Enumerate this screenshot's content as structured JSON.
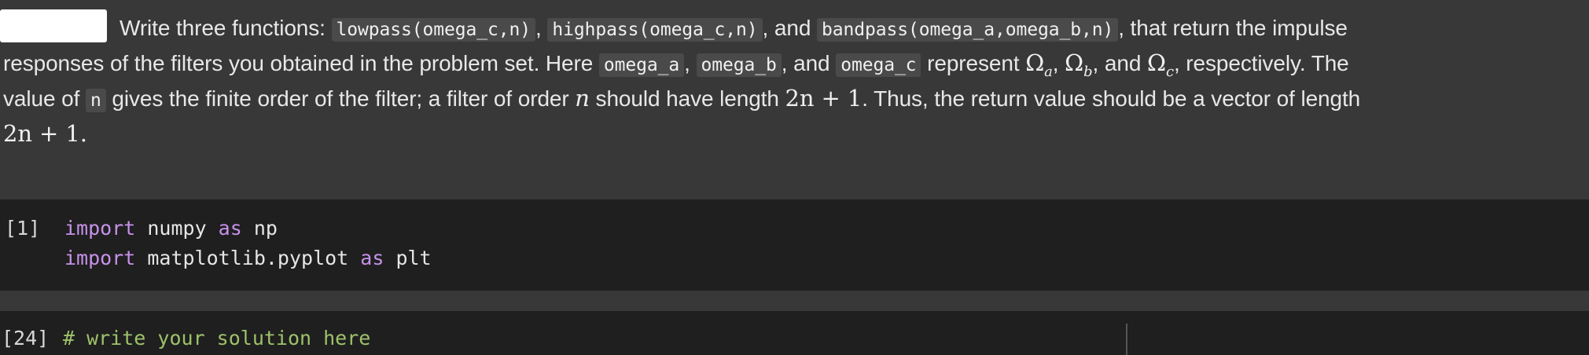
{
  "markdown_cell": {
    "line1": {
      "intro": "Write three functions: ",
      "code1": "lowpass(omega_c,n)",
      "sep1": ", ",
      "code2": "highpass(omega_c,n)",
      "sep2": ", and ",
      "code3": "bandpass(omega_a,omega_b,n)",
      "tail": ", that return the impulse"
    },
    "line2": {
      "text1": "responses of the filters you obtained in the problem set. Here ",
      "code_a": "omega_a",
      "sep1": ", ",
      "code_b": "omega_b",
      "sep2": ", and ",
      "code_c": "omega_c",
      "text2": " represent ",
      "omega": "Ω",
      "sub_a": "a",
      "sub_b": "b",
      "sub_c": "c",
      "comma": ", ",
      "and": ", and ",
      "tail": ", respectively. The"
    },
    "line3": {
      "text1": "value of ",
      "code_n": "n",
      "text2": " gives the finite order of the filter; a filter of order ",
      "var_n": "n",
      "text3": " should have length ",
      "math_len": "2n + 1",
      "text4": ". Thus, the return value should be a vector of length"
    },
    "line4": {
      "math_len": "2n + 1",
      "period": "."
    }
  },
  "code_cells": [
    {
      "label": "[1]",
      "lines": [
        {
          "kw1": "import",
          "mid": " numpy ",
          "kw2": "as",
          "end": " np"
        },
        {
          "kw1": "import",
          "mid": " matplotlib.pyplot ",
          "kw2": "as",
          "end": " plt"
        }
      ]
    },
    {
      "label": "[24]",
      "comment": "# write your solution here"
    }
  ]
}
